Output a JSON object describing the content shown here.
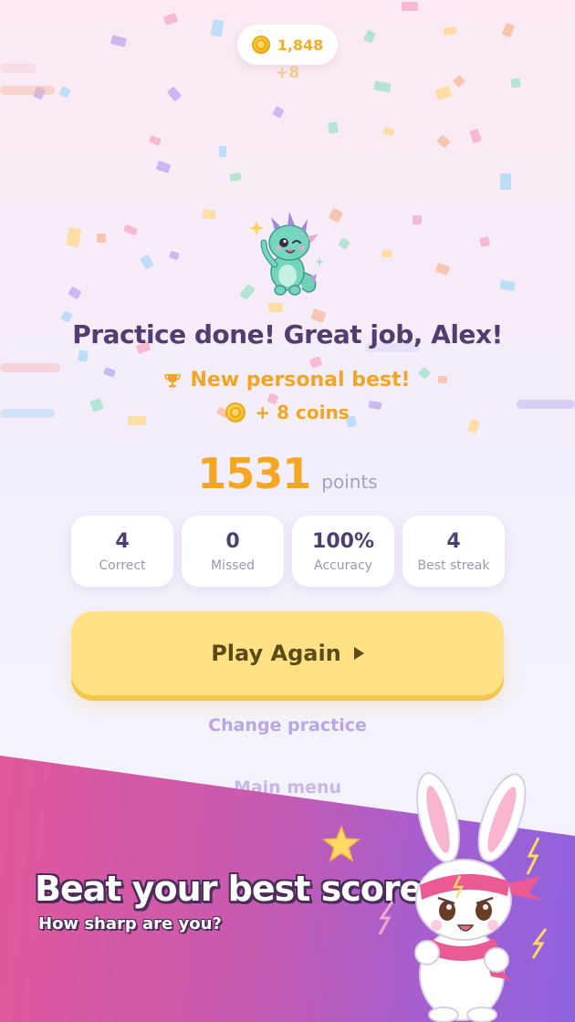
{
  "header": {
    "coin_balance": "1,848",
    "coin_gain": "+8",
    "coin_icon": "coin-icon"
  },
  "result": {
    "title": "Practice done! Great job, Alex!",
    "personal_best": "New personal best!",
    "coins_earned": "+ 8 coins",
    "points_value": "1531",
    "points_label": "points"
  },
  "stats": [
    {
      "value": "4",
      "label": "Correct"
    },
    {
      "value": "0",
      "label": "Missed"
    },
    {
      "value": "100%",
      "label": "Accuracy"
    },
    {
      "value": "4",
      "label": "Best streak"
    }
  ],
  "actions": {
    "play_again": "Play Again",
    "change_practice": "Change practice",
    "main_menu": "Main menu"
  },
  "banner": {
    "title": "Beat your best score!",
    "subtitle": "How sharp are you?"
  },
  "colors": {
    "accent_gold": "#f5a623",
    "title_purple": "#4e3f70",
    "button_yellow": "#ffe186",
    "banner_pink": "#e0579b",
    "banner_purple": "#8f63df"
  }
}
